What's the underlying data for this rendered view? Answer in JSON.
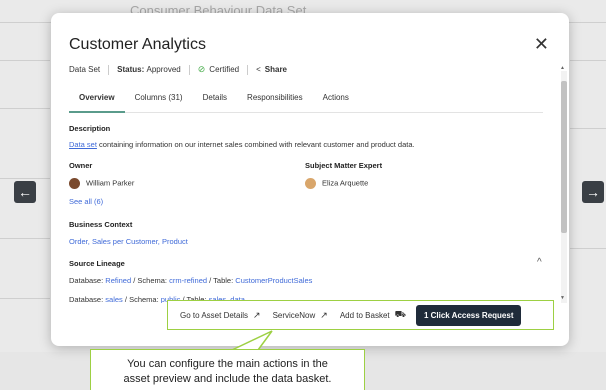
{
  "background": {
    "title": "Consumer Behaviour Data Set"
  },
  "nav": {
    "prev_icon": "←",
    "next_icon": "→"
  },
  "modal": {
    "title": "Customer Analytics",
    "close_icon": "✕",
    "meta": {
      "type": "Data Set",
      "status_label": "Status:",
      "status_value": "Approved",
      "certified": "Certified",
      "share": "Share"
    },
    "tabs": [
      {
        "label": "Overview",
        "active": true
      },
      {
        "label": "Columns (31)"
      },
      {
        "label": "Details"
      },
      {
        "label": "Responsibilities"
      },
      {
        "label": "Actions"
      }
    ],
    "description": {
      "heading": "Description",
      "link": "Data set",
      "text": " containing information on our internet sales combined with relevant customer and product data."
    },
    "owner": {
      "heading": "Owner",
      "name": "William Parker",
      "see_all": "See all (6)"
    },
    "sme": {
      "heading": "Subject Matter Expert",
      "name": "Eliza Arquette"
    },
    "business_context": {
      "heading": "Business Context",
      "items": [
        "Order,",
        "Sales per Customer,",
        "Product"
      ]
    },
    "lineage": {
      "heading": "Source Lineage",
      "collapse_icon": "^",
      "row1": {
        "db_label": "Database:",
        "db_value": "Refined",
        "schema_label": "/ Schema:",
        "schema_value": "crm-refined",
        "table_label": "/ Table:",
        "table_value": "CustomerProductSales"
      },
      "row2": {
        "db_label": "Database:",
        "db_value": "sales",
        "schema_label": "/ Schema:",
        "schema_value": "public",
        "table_label": "/ Table:",
        "table_value": "sales_data"
      }
    }
  },
  "actions": {
    "asset_details": "Go to Asset Details",
    "servicenow": "ServiceNow",
    "basket": "Add to Basket",
    "access_request": "1 Click Access Request"
  },
  "tooltip": {
    "line1": "You can configure the main actions in the",
    "line2": "asset preview and include the data basket."
  },
  "colors": {
    "accent": "#9dd043",
    "link": "#3f6ad8",
    "primary_button": "#1f2b3a",
    "tab_underline": "#5a9b8b"
  }
}
